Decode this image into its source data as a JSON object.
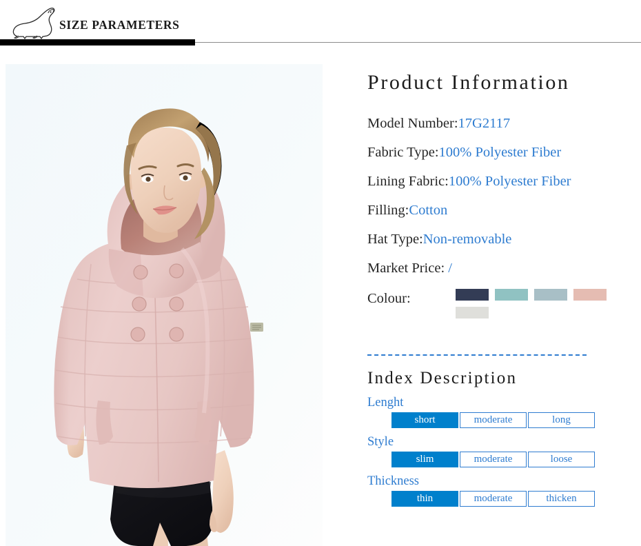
{
  "header": {
    "title": "SIZE PARAMETERS",
    "logo_icon": "seal-logo-icon"
  },
  "photo": {
    "alt": "Model wearing pink hooded puffer jacket",
    "garment_color": "#e8c9c6",
    "background_color": "#f4f9fb"
  },
  "product_information": {
    "title": "Product Information",
    "specs": [
      {
        "label": "Model Number:",
        "value": "17G2117"
      },
      {
        "label": "Fabric Type:",
        "value": "100% Polyester Fiber"
      },
      {
        "label": "Lining Fabric:",
        "value": "100% Polyester Fiber"
      },
      {
        "label": "Filling:",
        "value": "Cotton"
      },
      {
        "label": "Hat Type:",
        "value": "Non-removable"
      },
      {
        "label": "Market Price:",
        "value": "  /"
      }
    ],
    "colour": {
      "label": "Colour:",
      "swatches": [
        "#333c55",
        "#90c2c2",
        "#a8bfc6",
        "#e5bcb2",
        "#dfdfdb"
      ]
    }
  },
  "index_description": {
    "title": "Index Description",
    "groups": [
      {
        "label": "Lenght",
        "options": [
          {
            "text": "short",
            "active": true
          },
          {
            "text": "moderate",
            "active": false
          },
          {
            "text": "long",
            "active": false
          }
        ]
      },
      {
        "label": "Style",
        "options": [
          {
            "text": "slim",
            "active": true
          },
          {
            "text": "moderate",
            "active": false
          },
          {
            "text": "loose",
            "active": false
          }
        ]
      },
      {
        "label": "Thickness",
        "options": [
          {
            "text": "thin",
            "active": true
          },
          {
            "text": "moderate",
            "active": false
          },
          {
            "text": "thicken",
            "active": false
          }
        ]
      }
    ]
  },
  "colors": {
    "accent_blue": "#2e7cd0",
    "active_blue": "#0080cc",
    "header_bar": "#000000",
    "text": "#262626"
  }
}
